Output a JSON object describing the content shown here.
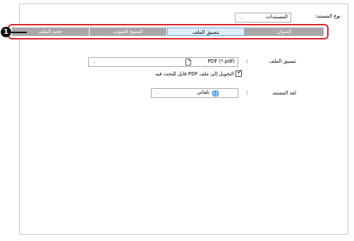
{
  "header": {
    "doc_type_label": "نوع المستند:",
    "doc_type_value": "المستندات"
  },
  "tabs": [
    {
      "label": "العنوان"
    },
    {
      "label": "تنسيق الملف"
    },
    {
      "label": "المسح الضوئي"
    },
    {
      "label": "حجم الملف"
    }
  ],
  "callout": "1",
  "file_format": {
    "label": "تنسيق الملف",
    "colon": ":",
    "value": "PDF (*.pdf)",
    "icon": "document-icon"
  },
  "convert_checkbox": {
    "label": "التحويل إلى ملف PDF قابل للبحث فيه",
    "checked": true,
    "mark": "✓"
  },
  "doc_language": {
    "label": "لغة المستند",
    "colon": ":",
    "value": "تلقائي",
    "icon": "globe-icon"
  },
  "chevron": "⌵",
  "colors": {
    "callout_border": "#e0222b",
    "tab_inactive": "#a8a8a8",
    "tab_active": "#dcecf9",
    "globe": "#2f8de4"
  }
}
